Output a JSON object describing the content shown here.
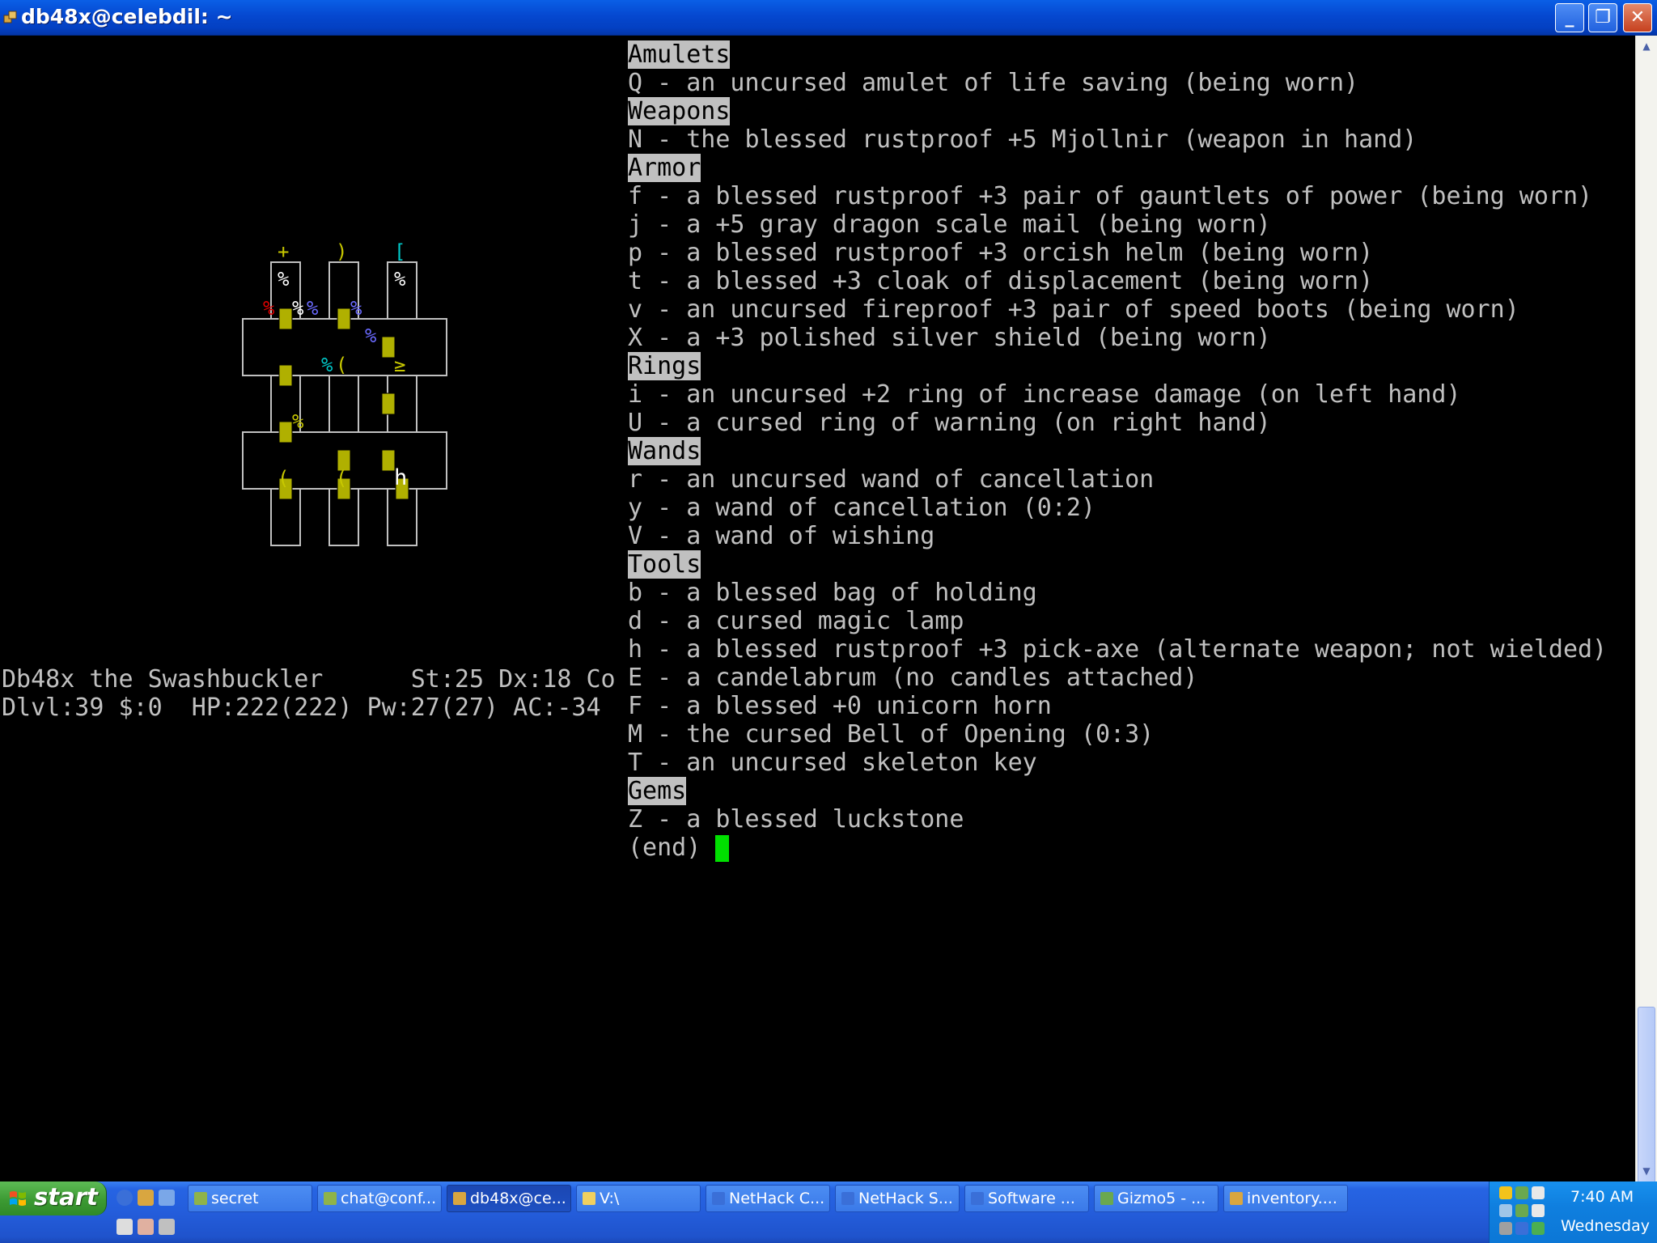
{
  "window": {
    "title": "db48x@celebdil: ~",
    "minimize_glyph": "_",
    "maximize_glyph": "❐",
    "close_glyph": "✕"
  },
  "scrollbar": {
    "up_glyph": "▲",
    "down_glyph": "▼"
  },
  "inventory": {
    "lines": [
      {
        "text": "Amulets",
        "header": true
      },
      {
        "text": "Q - an uncursed amulet of life saving (being worn)"
      },
      {
        "text": "Weapons",
        "header": true
      },
      {
        "text": "N - the blessed rustproof +5 Mjollnir (weapon in hand)"
      },
      {
        "text": "Armor",
        "header": true
      },
      {
        "text": "f - a blessed rustproof +3 pair of gauntlets of power (being worn)"
      },
      {
        "text": "j - a +5 gray dragon scale mail (being worn)"
      },
      {
        "text": "p - a blessed rustproof +3 orcish helm (being worn)"
      },
      {
        "text": "t - a blessed +3 cloak of displacement (being worn)"
      },
      {
        "text": "v - an uncursed fireproof +3 pair of speed boots (being worn)"
      },
      {
        "text": "X - a +3 polished silver shield (being worn)"
      },
      {
        "text": "Rings",
        "header": true
      },
      {
        "text": "i - an uncursed +2 ring of increase damage (on left hand)"
      },
      {
        "text": "U - a cursed ring of warning (on right hand)"
      },
      {
        "text": "Wands",
        "header": true
      },
      {
        "text": "r - an uncursed wand of cancellation"
      },
      {
        "text": "y - a wand of cancellation (0:2)"
      },
      {
        "text": "V - a wand of wishing"
      },
      {
        "text": "Tools",
        "header": true
      },
      {
        "text": "b - a blessed bag of holding"
      },
      {
        "text": "d - a cursed magic lamp"
      },
      {
        "text": "h - a blessed rustproof +3 pick-axe (alternate weapon; not wielded)"
      },
      {
        "text": "E - a candelabrum (no candles attached)"
      },
      {
        "text": "F - a blessed +0 unicorn horn"
      },
      {
        "text": "M - the cursed Bell of Opening (0:3)"
      },
      {
        "text": "T - an uncursed skeleton key"
      },
      {
        "text": "Gems",
        "header": true
      },
      {
        "text": "Z - a blessed luckstone"
      }
    ],
    "end_marker": "(end) "
  },
  "status": {
    "line1": "Db48x the Swashbuckler      St:25 Dx:18 Co",
    "line2": "Dlvl:39 $:0  HP:222(222) Pw:27(27) AC:-34"
  },
  "map": {
    "glyphs": [
      {
        "ch": "+",
        "color": "#c8c800"
      },
      {
        "ch": ")",
        "color": "#c8c800"
      },
      {
        "ch": "[",
        "color": "#00c8c8"
      },
      {
        "ch": "%",
        "color": "#ffffff"
      },
      {
        "ch": "%",
        "color": "#ffffff"
      },
      {
        "ch": "%",
        "color": "#e00000"
      },
      {
        "ch": "%",
        "color": "#ffffff"
      },
      {
        "ch": "%",
        "color": "#6a6aff"
      },
      {
        "ch": "%",
        "color": "#6a6aff"
      },
      {
        "ch": "%",
        "color": "#6a6aff"
      },
      {
        "ch": "%",
        "color": "#00c8c8"
      },
      {
        "ch": "(",
        "color": "#c8c800"
      },
      {
        "ch": "≥",
        "color": "#c8c800"
      },
      {
        "ch": "%",
        "color": "#c8c800"
      },
      {
        "ch": "(",
        "color": "#c8c800"
      },
      {
        "ch": "(",
        "color": "#c8c800"
      },
      {
        "ch": "h",
        "color": "#ffffff"
      }
    ],
    "door_color": "#b0b000",
    "wall_color": "#c0c0c0"
  },
  "taskbar": {
    "start_label": "start",
    "tasks": [
      {
        "label": "secret",
        "icon_color": "#8fb34a"
      },
      {
        "label": "chat@conf...",
        "icon_color": "#8fb34a"
      },
      {
        "label": "db48x@ce...",
        "icon_color": "#d9a640",
        "active": true
      },
      {
        "label": "V:\\",
        "icon_color": "#f0d060"
      },
      {
        "label": "NetHack C...",
        "icon_color": "#3a6fd8"
      },
      {
        "label": "NetHack S...",
        "icon_color": "#3a6fd8"
      },
      {
        "label": "Software ...",
        "icon_color": "#3a6fd8"
      },
      {
        "label": "Gizmo5 - ...",
        "icon_color": "#6aa84f"
      },
      {
        "label": "inventory....",
        "icon_color": "#d9a640"
      }
    ],
    "clock_time": "7:40 AM",
    "clock_day": "Wednesday"
  }
}
